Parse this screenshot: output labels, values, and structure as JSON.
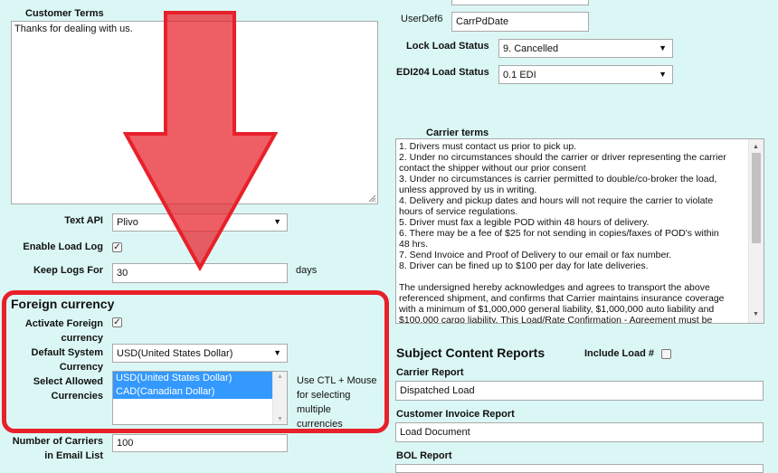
{
  "customer_terms": {
    "label": "Customer Terms",
    "value": "Thanks for dealing with us."
  },
  "userdef6": {
    "label": "UserDef6",
    "value": "CarrPdDate"
  },
  "lock_load_status": {
    "label": "Lock Load Status",
    "value": "9. Cancelled"
  },
  "edi204_load_status": {
    "label": "EDI204 Load Status",
    "value": "0.1 EDI"
  },
  "carrier_terms": {
    "label": "Carrier terms",
    "lines": [
      "1. Drivers must contact us prior to pick up.",
      "2. Under no circumstances should the carrier or driver representing the carrier",
      "contact the shipper without our prior consent",
      "3. Under no circumstances is carrier permitted to double/co-broker the load,",
      "unless approved by us in writing.",
      "4. Delivery and pickup dates and hours will not require the carrier to violate",
      "hours of service regulations.",
      "5. Driver must fax a legible POD within 48 hours of delivery.",
      "6. There may be a fee of $25 for not sending in copies/faxes of POD's within",
      "48 hrs.",
      "7. Send Invoice and Proof of Delivery to our email or fax number.",
      "8. Driver can be fined up to $100 per day for late deliveries.",
      "",
      "The undersigned hereby acknowledges and agrees to transport the above",
      "referenced shipment, and confirms that Carrier maintains insurance coverage",
      "with a minimum of $1,000,000 general liability, $1,000,000 auto liability and",
      "$100,000 cargo liability. This Load/Rate Confirmation - Agreement must be"
    ]
  },
  "text_api": {
    "label": "Text API",
    "value": "Plivo"
  },
  "enable_load_log": {
    "label": "Enable Load Log",
    "checked": true
  },
  "keep_logs_for": {
    "label": "Keep Logs For",
    "value": "30",
    "unit": "days"
  },
  "foreign_currency": {
    "title": "Foreign currency",
    "activate": {
      "label_line1": "Activate Foreign",
      "label_line2": "currency",
      "checked": true
    },
    "default_currency": {
      "label_line1": "Default System",
      "label_line2": "Currency",
      "value": "USD(United States Dollar)"
    },
    "allowed": {
      "label_line1": "Select Allowed",
      "label_line2": "Currencies",
      "options": [
        "USD(United States Dollar)",
        "CAD(Canadian Dollar)"
      ]
    },
    "hint_lines": [
      "Use CTL + Mouse",
      "for selecting",
      "multiple",
      "currencies"
    ]
  },
  "number_of_carriers": {
    "label_line1": "Number of Carriers",
    "label_line2": "in Email List",
    "value": "100"
  },
  "subject_content_reports": {
    "title": "Subject Content Reports",
    "include_load_label": "Include Load #",
    "include_load_checked": false,
    "carrier_report": {
      "label": "Carrier Report",
      "value": "Dispatched Load"
    },
    "customer_invoice_report": {
      "label": "Customer Invoice Report",
      "value": "Load Document"
    },
    "bol_report": {
      "label": "BOL Report"
    }
  },
  "colors": {
    "background": "#dbf7f5",
    "highlight_red": "#e8202a",
    "selection_blue": "#3399ff"
  }
}
